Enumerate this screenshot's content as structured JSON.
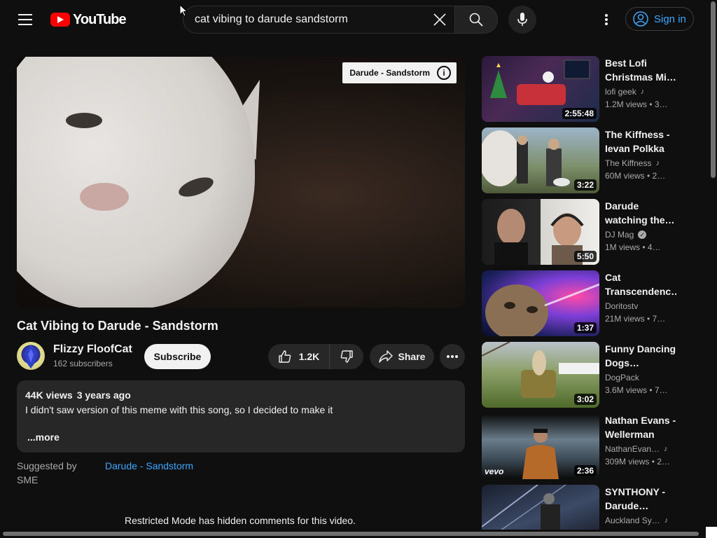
{
  "header": {
    "logo_text": "YouTube",
    "search_value": "cat vibing to darude sandstorm",
    "signin_label": "Sign in"
  },
  "player": {
    "info_chip": "Darude - Sandstorm",
    "info_icon_text": "i"
  },
  "video": {
    "title": "Cat Vibing to Darude - Sandstorm",
    "channel": "Flizzy FloofCat",
    "subscribers": "162 subscribers",
    "subscribe_label": "Subscribe",
    "likes": "1.2K",
    "share_label": "Share"
  },
  "description": {
    "views": "44K views",
    "age": "3 years ago",
    "text": "I didn't saw version of this meme with this song, so I decided to make it",
    "more_label": "...more"
  },
  "suggested": {
    "label": "Suggested by SME",
    "link": "Darude - Sandstorm"
  },
  "comments_notice": "Restricted Mode has hidden comments for this video.",
  "sidebar": {
    "items": [
      {
        "title": "Best Lofi Christmas Mi…",
        "channel": "lofi geek",
        "badge": "music",
        "meta": "1.2M views  • 3…",
        "duration": "2:55:48"
      },
      {
        "title": "The Kiffness - Ievan Polkka f…",
        "channel": "The Kiffness",
        "badge": "music",
        "meta": "60M views  • 2…",
        "duration": "3:22"
      },
      {
        "title": "Darude watching the…",
        "channel": "DJ Mag",
        "badge": "verified",
        "meta": "1M views  • 4…",
        "duration": "5:50"
      },
      {
        "title": "Cat Transcendenc…",
        "channel": "Doritostv",
        "badge": "",
        "meta": "21M views  • 7…",
        "duration": "1:37"
      },
      {
        "title": "Funny Dancing Dogs…",
        "channel": "DogPack",
        "badge": "",
        "meta": "3.6M views  • 7…",
        "duration": "3:02"
      },
      {
        "title": "Nathan Evans - Wellerman (S…",
        "channel": "NathanEvan…",
        "badge": "music",
        "meta": "309M views  • 2…",
        "duration": "2:36",
        "watermark": "vevo"
      },
      {
        "title": "SYNTHONY - Darude…",
        "channel": "Auckland Sy…",
        "badge": "music",
        "meta": "",
        "duration": ""
      }
    ]
  },
  "colors": {
    "background": "#0f0f0f",
    "accent_link": "#3ea6ff",
    "logo_red": "#ff0000",
    "chip_bg": "#272727"
  }
}
